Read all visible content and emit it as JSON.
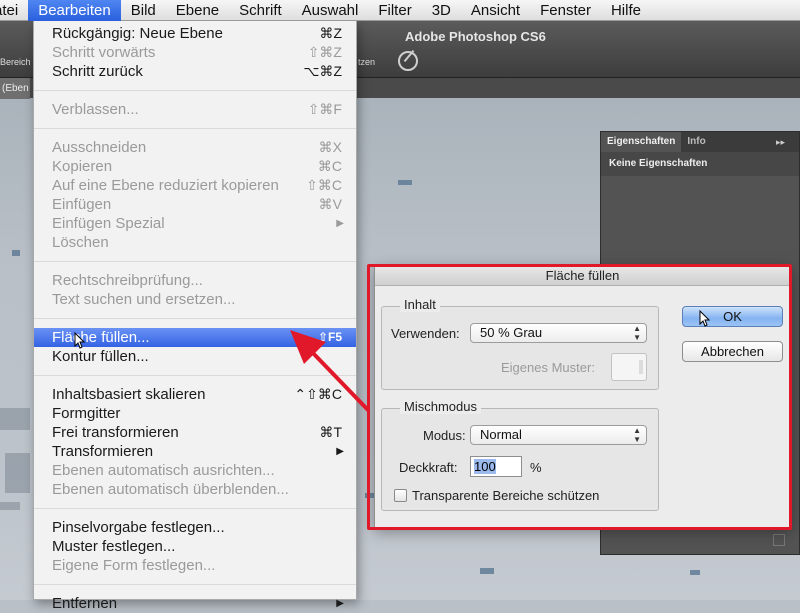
{
  "menubar": {
    "items": [
      "atei",
      "Bearbeiten",
      "Bild",
      "Ebene",
      "Schrift",
      "Auswahl",
      "Filter",
      "3D",
      "Ansicht",
      "Fenster",
      "Hilfe"
    ],
    "active_index": 1
  },
  "app": {
    "title": "Adobe Photoshop CS6",
    "options_left_fragment": "Bereich",
    "options_right_fragment": "tzen",
    "doc_tab_fragment": "(Eben"
  },
  "edit_menu": {
    "items": [
      {
        "label": "Rückgängig: Neue Ebene",
        "shortcut": "⌘Z",
        "disabled": false
      },
      {
        "label": "Schritt vorwärts",
        "shortcut": "⇧⌘Z",
        "disabled": true
      },
      {
        "label": "Schritt zurück",
        "shortcut": "⌥⌘Z",
        "disabled": false
      },
      {
        "sep": true
      },
      {
        "label": "Verblassen...",
        "shortcut": "⇧⌘F",
        "disabled": true
      },
      {
        "sep": true
      },
      {
        "label": "Ausschneiden",
        "shortcut": "⌘X",
        "disabled": true
      },
      {
        "label": "Kopieren",
        "shortcut": "⌘C",
        "disabled": true
      },
      {
        "label": "Auf eine Ebene reduziert kopieren",
        "shortcut": "⇧⌘C",
        "disabled": true
      },
      {
        "label": "Einfügen",
        "shortcut": "⌘V",
        "disabled": true
      },
      {
        "label": "Einfügen Spezial",
        "submenu": true,
        "disabled": true
      },
      {
        "label": "Löschen",
        "disabled": true
      },
      {
        "sep": true
      },
      {
        "label": "Rechtschreibprüfung...",
        "disabled": true
      },
      {
        "label": "Text suchen und ersetzen...",
        "disabled": true
      },
      {
        "sep": true
      },
      {
        "label": "Fläche füllen...",
        "shortcut": "⇧F5",
        "highlighted": true
      },
      {
        "label": "Kontur füllen...",
        "disabled": false
      },
      {
        "sep": true
      },
      {
        "label": "Inhaltsbasiert skalieren",
        "shortcut": "⌃⇧⌘C",
        "disabled": false
      },
      {
        "label": "Formgitter",
        "disabled": false
      },
      {
        "label": "Frei transformieren",
        "shortcut": "⌘T",
        "disabled": false
      },
      {
        "label": "Transformieren",
        "submenu": true,
        "disabled": false
      },
      {
        "label": "Ebenen automatisch ausrichten...",
        "disabled": true
      },
      {
        "label": "Ebenen automatisch überblenden...",
        "disabled": true
      },
      {
        "sep": true
      },
      {
        "label": "Pinselvorgabe festlegen...",
        "disabled": false
      },
      {
        "label": "Muster festlegen...",
        "disabled": false
      },
      {
        "label": "Eigene Form festlegen...",
        "disabled": true
      },
      {
        "sep": true
      },
      {
        "label": "Entfernen",
        "submenu": true,
        "disabled": false
      }
    ]
  },
  "properties_panel": {
    "tabs": [
      "Eigenschaften",
      "Info"
    ],
    "arrows": "▸▸",
    "content": "Keine Eigenschaften"
  },
  "fill_dialog": {
    "title": "Fläche füllen",
    "content_group": {
      "title": "Inhalt",
      "use_label": "Verwenden:",
      "use_value": "50 % Grau",
      "custom_pattern_label": "Eigenes Muster:"
    },
    "blend_group": {
      "title": "Mischmodus",
      "mode_label": "Modus:",
      "mode_value": "Normal",
      "opacity_label": "Deckkraft:",
      "opacity_value": "100",
      "opacity_unit": "%",
      "preserve_label": "Transparente Bereiche schützen"
    },
    "ok_label": "OK",
    "cancel_label": "Abbrechen"
  },
  "colors": {
    "accent_blue": "#3463e3",
    "annotation_red": "#e0182a"
  }
}
